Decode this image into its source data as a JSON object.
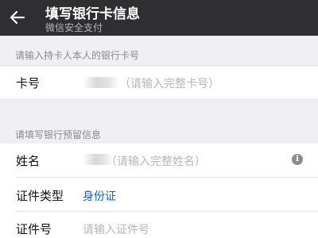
{
  "header": {
    "title": "填写银行卡信息",
    "subtitle": "微信安全支付"
  },
  "section1": {
    "label": "请输入持卡人本人的银行卡号"
  },
  "card": {
    "label": "卡号",
    "placeholder": "（请输入完整卡号）"
  },
  "section2": {
    "label": "请填写银行预留信息"
  },
  "name": {
    "label": "姓名",
    "placeholder": "（请输入完整姓名）"
  },
  "id_type": {
    "label": "证件类型",
    "value": "身份证"
  },
  "id_number": {
    "label": "证件号",
    "placeholder": "请输入证件号"
  },
  "icons": {
    "back": "arrow-left-icon",
    "info": "info-icon"
  },
  "colors": {
    "header_bg": "#2f2f31",
    "accent": "#1a5fb4",
    "page_bg": "#efeff4"
  }
}
